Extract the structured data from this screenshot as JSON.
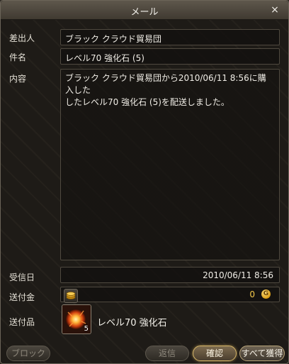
{
  "window": {
    "title": "メール",
    "close_symbol": "×"
  },
  "labels": {
    "sender": "差出人",
    "subject": "件名",
    "content": "内容",
    "received": "受信日",
    "money": "送付金",
    "items": "送付品"
  },
  "mail": {
    "sender": "ブラック クラウド貿易団",
    "subject": "レベル70 強化石 (5)",
    "content": "ブラック クラウド貿易団から2010/06/11 8:56に購入した\nしたレベル70 強化石 (5)を配送しました。",
    "received_date": "2010/06/11  8:56",
    "money_amount": "0",
    "coin_symbol": "G"
  },
  "attachment": {
    "name": "レベル70  強化石",
    "count": "5",
    "icon": "enhancement-stone-icon"
  },
  "buttons": {
    "block": "ブロック",
    "reply": "返信",
    "confirm": "確認",
    "take_all": "すべて獲得"
  }
}
